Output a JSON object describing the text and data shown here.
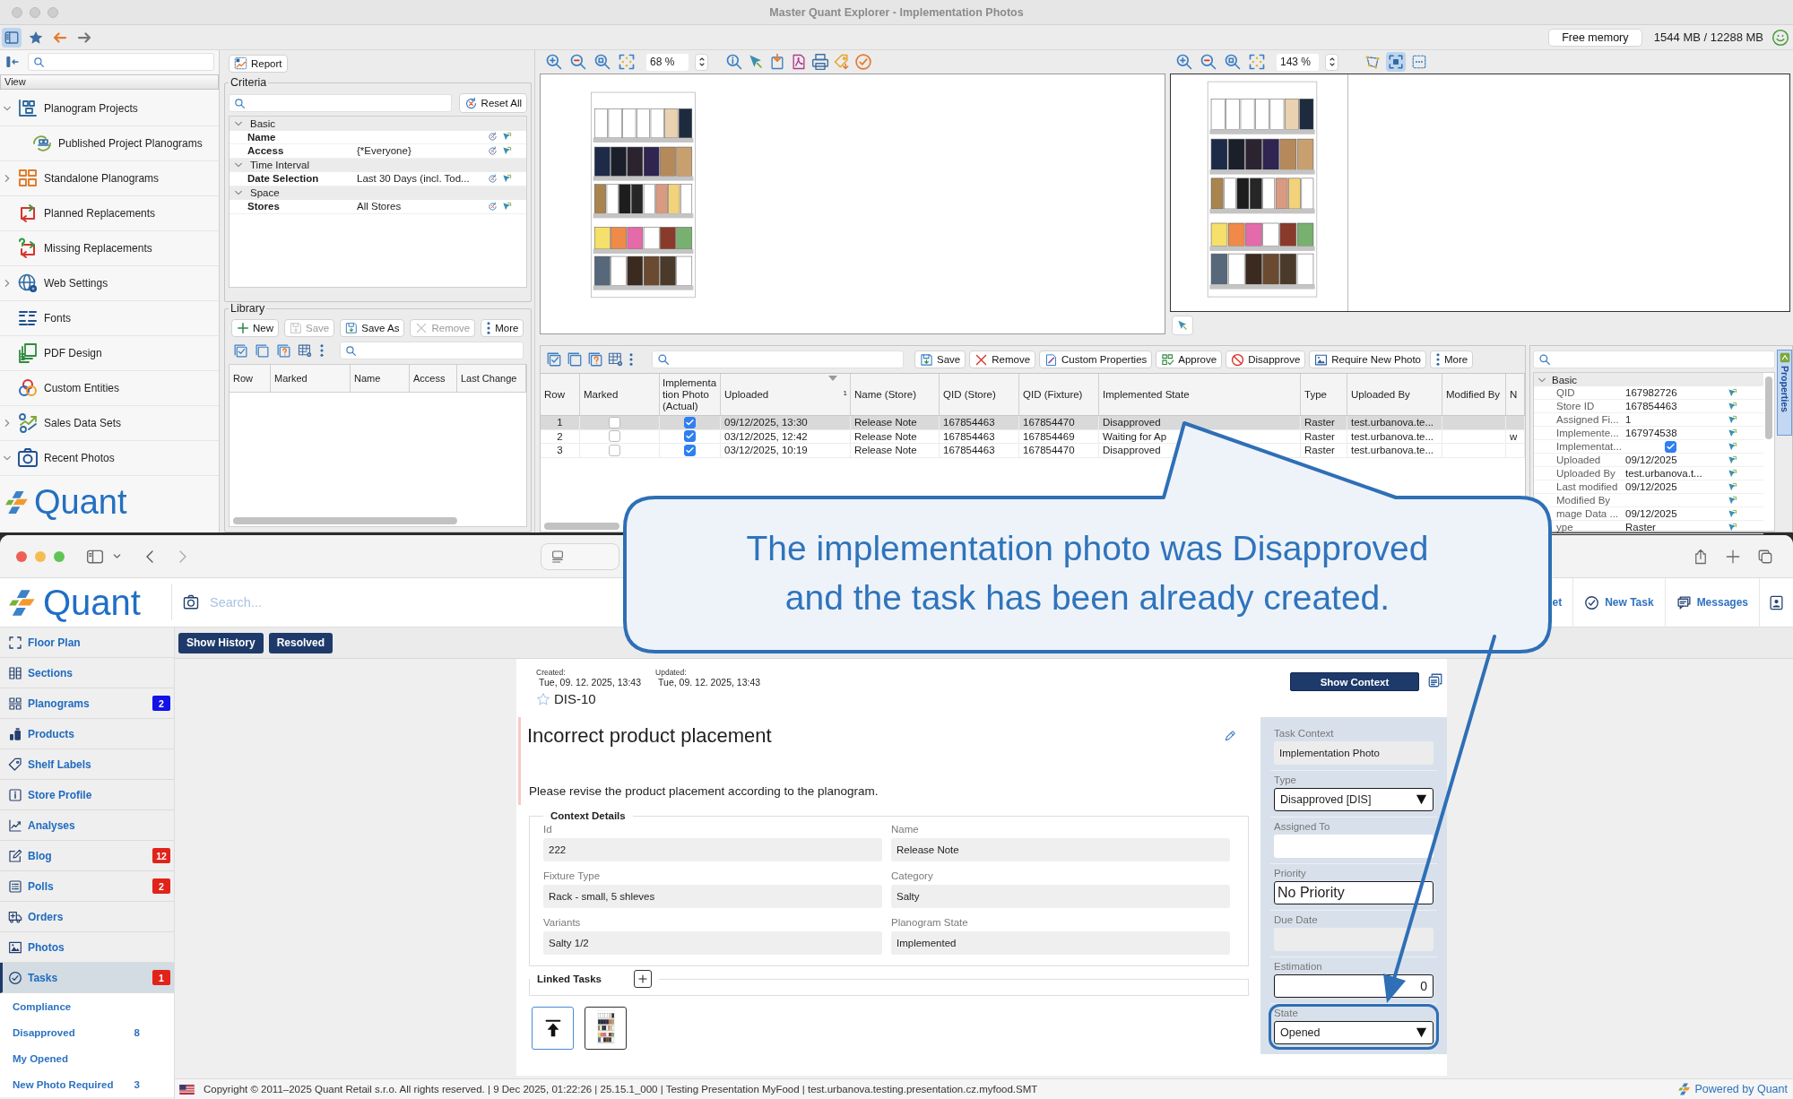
{
  "explorer": {
    "title": "Master Quant Explorer - Implementation Photos",
    "sidebar_toggle": {
      "selected": true
    },
    "memory": {
      "button": "Free memory",
      "reading": "1544 MB / 12288 MB"
    },
    "navigator": {
      "header": "View",
      "items": [
        {
          "label": "Planogram Projects",
          "kind": "group",
          "expanded": true,
          "children": [
            {
              "label": "Published Project Planograms",
              "kind": "item"
            }
          ]
        },
        {
          "label": "Standalone Planograms",
          "kind": "group",
          "expanded": false
        },
        {
          "label": "Planned Replacements",
          "kind": "item"
        },
        {
          "label": "Missing Replacements",
          "kind": "item"
        },
        {
          "label": "Web Settings",
          "kind": "group",
          "expanded": false
        },
        {
          "label": "Fonts",
          "kind": "item"
        },
        {
          "label": "PDF Design",
          "kind": "item"
        },
        {
          "label": "Custom Entities",
          "kind": "item"
        },
        {
          "label": "Sales Data Sets",
          "kind": "group",
          "expanded": false
        },
        {
          "label": "Recent Photos",
          "kind": "group",
          "expanded": true
        }
      ],
      "logo": "Quant"
    },
    "report_button": "Report",
    "criteria": {
      "title": "Criteria",
      "reset_button": "Reset All",
      "groups": [
        {
          "label": "Basic",
          "expanded": true,
          "rows": [
            {
              "name": "Name"
            },
            {
              "name": "Access",
              "value": "{*Everyone}"
            }
          ]
        },
        {
          "label": "Time Interval",
          "expanded": true,
          "rows": [
            {
              "name": "Date Selection",
              "value": "Last 30 Days (incl. Tod..."
            }
          ]
        },
        {
          "label": "Space",
          "expanded": true,
          "rows": [
            {
              "name": "Stores",
              "value": "All Stores"
            }
          ]
        }
      ]
    },
    "library": {
      "title": "Library",
      "buttons": [
        {
          "label": "New",
          "disabled": false
        },
        {
          "label": "Save",
          "disabled": true
        },
        {
          "label": "Save As",
          "disabled": false
        },
        {
          "label": "Remove",
          "disabled": true
        },
        {
          "label": "More",
          "disabled": false
        }
      ],
      "columns": [
        "Row",
        "Marked",
        "Name",
        "Access",
        "Last Change"
      ]
    },
    "plan_viewer": {
      "zoom": "68 %"
    },
    "photo_viewer": {
      "zoom": "143 %",
      "tools": [
        {
          "selected": false
        },
        {
          "selected": true
        },
        {
          "selected": false
        }
      ]
    },
    "photo_table": {
      "buttons": [
        "Save",
        "Remove",
        "Custom Properties",
        "Approve",
        "Disapprove",
        "Require New Photo",
        "More"
      ],
      "columns": [
        {
          "label": "Row"
        },
        {
          "label": "Marked"
        },
        {
          "label": "Implementation Photo (Actual)"
        },
        {
          "label": "Uploaded",
          "sort_order": "1"
        },
        {
          "label": "Name (Store)"
        },
        {
          "label": "QID (Store)"
        },
        {
          "label": "QID (Fixture)"
        },
        {
          "label": "Implemented State"
        },
        {
          "label": "Type"
        },
        {
          "label": "Uploaded By"
        },
        {
          "label": "Modified By"
        },
        {
          "label": "N"
        }
      ],
      "rows": [
        {
          "selected": true,
          "row": "1",
          "marked": false,
          "photo_actual": true,
          "uploaded": "09/12/2025, 13:30",
          "name_store": "Release Note",
          "qid_store": "167854463",
          "qid_fixture": "167854470",
          "implemented_state": "Disapproved",
          "type": "Raster",
          "uploaded_by": "test.urbanova.te..."
        },
        {
          "selected": false,
          "row": "2",
          "marked": false,
          "photo_actual": true,
          "uploaded": "03/12/2025, 12:42",
          "name_store": "Release Note",
          "qid_store": "167854463",
          "qid_fixture": "167854469",
          "implemented_state": "Waiting for Ap",
          "type": "Raster",
          "uploaded_by": "test.urbanova.te...",
          "column_12": "w"
        },
        {
          "selected": false,
          "row": "3",
          "marked": false,
          "photo_actual": true,
          "uploaded": "03/12/2025, 10:19",
          "name_store": "Release Note",
          "qid_store": "167854463",
          "qid_fixture": "167854470",
          "implemented_state": "Disapproved",
          "type": "Raster",
          "uploaded_by": "test.urbanova.te..."
        }
      ]
    },
    "properties": {
      "tab": "Properties",
      "group": {
        "label": "Basic",
        "expanded": true
      },
      "rows": [
        {
          "kind": "text",
          "name": "QID",
          "value": "167982726"
        },
        {
          "kind": "text",
          "name": "Store ID",
          "value": "167854463"
        },
        {
          "kind": "text",
          "name": "Assigned Fi...",
          "value": "1"
        },
        {
          "kind": "text",
          "name": "Implemente...",
          "value": "167974538"
        },
        {
          "kind": "checkbox",
          "name": "Implementat...",
          "checked": true
        },
        {
          "kind": "text",
          "name": "Uploaded",
          "value": "09/12/2025"
        },
        {
          "kind": "text",
          "name": "Uploaded By",
          "value": "test.urbanova.t..."
        },
        {
          "kind": "text",
          "name": "Last modified",
          "value": "09/12/2025"
        },
        {
          "kind": "text",
          "name": "Modified By"
        },
        {
          "kind": "text",
          "name": "mage Data ...",
          "value": "09/12/2025"
        },
        {
          "kind": "text",
          "name": "ype",
          "value": "Raster"
        }
      ]
    }
  },
  "browser": {
    "logo": "Quant",
    "search_placeholder": "Search...",
    "header_links": [
      "et",
      "New Task",
      "Messages"
    ],
    "nav": [
      {
        "label": "Floor Plan",
        "selected": false
      },
      {
        "label": "Sections",
        "selected": false
      },
      {
        "label": "Planograms",
        "selected": false,
        "badge": {
          "text": "2",
          "color": "#1212e8"
        }
      },
      {
        "label": "Products",
        "selected": false
      },
      {
        "label": "Shelf Labels",
        "selected": false
      },
      {
        "label": "Store Profile",
        "selected": false
      },
      {
        "label": "Analyses",
        "selected": false
      },
      {
        "label": "Blog",
        "selected": false,
        "badge": {
          "text": "12",
          "color": "#e2231a"
        }
      },
      {
        "label": "Polls",
        "selected": false,
        "badge": {
          "text": "2",
          "color": "#e2231a"
        }
      },
      {
        "label": "Orders",
        "selected": false
      },
      {
        "label": "Photos",
        "selected": false
      },
      {
        "label": "Tasks",
        "selected": true,
        "badge": {
          "text": "1",
          "color": "#e2231a"
        }
      }
    ],
    "subnav": [
      {
        "label": "Compliance"
      },
      {
        "label": "Disapproved",
        "count": "8"
      },
      {
        "label": "My Opened"
      },
      {
        "label": "New Photo Required",
        "count": "3"
      }
    ],
    "actions": [
      "Show History",
      "Resolved"
    ],
    "task": {
      "created_label": "Created:",
      "created": "Tue, 09. 12. 2025, 13:43",
      "updated_label": "Updated:",
      "updated": "Tue, 09. 12. 2025, 13:43",
      "starred": false,
      "key": "DIS-10",
      "show_context": "Show Context",
      "title": "Incorrect product placement",
      "description": "Please revise the product placement according to the planogram.",
      "context_details": {
        "title": "Context Details",
        "fields": [
          {
            "label": "Id",
            "value": "222"
          },
          {
            "label": "Name",
            "value": "Release Note"
          },
          {
            "label": "Fixture Type",
            "value": "Rack - small, 5 shleves"
          },
          {
            "label": "Category",
            "value": "Salty"
          },
          {
            "label": "Variants",
            "value": "Salty 1/2"
          },
          {
            "label": "Planogram State",
            "value": "Implemented"
          }
        ]
      },
      "linked_tasks": "Linked Tasks",
      "side_fields": [
        {
          "label": "Task Context",
          "kind": "readonly",
          "value": "Implementation Photo",
          "highlighted": false
        },
        {
          "label": "Type",
          "kind": "select",
          "value": "Disapproved [DIS]",
          "highlighted": false
        },
        {
          "label": "Assigned To",
          "kind": "input",
          "highlighted": false
        },
        {
          "label": "Priority",
          "kind": "text",
          "value": "No Priority",
          "highlighted": false
        },
        {
          "label": "Due Date",
          "kind": "readonly",
          "highlighted": false
        },
        {
          "label": "Estimation",
          "kind": "number",
          "value": "0",
          "highlighted": false
        },
        {
          "label": "State",
          "kind": "select",
          "value": "Opened",
          "highlighted": true
        }
      ]
    },
    "footer": {
      "text": "Copyright © 2011–2025 Quant Retail s.r.o. All rights reserved. | 9 Dec 2025, 01:22:26 | 25.15.1_000 | Testing Presentation MyFood | test.urbanova.testing.presentation.cz.myfood.SMT",
      "powered_by": "Powered by Quant"
    }
  },
  "callout": {
    "text": "The implementation photo was Disapproved and the task has been already created."
  }
}
